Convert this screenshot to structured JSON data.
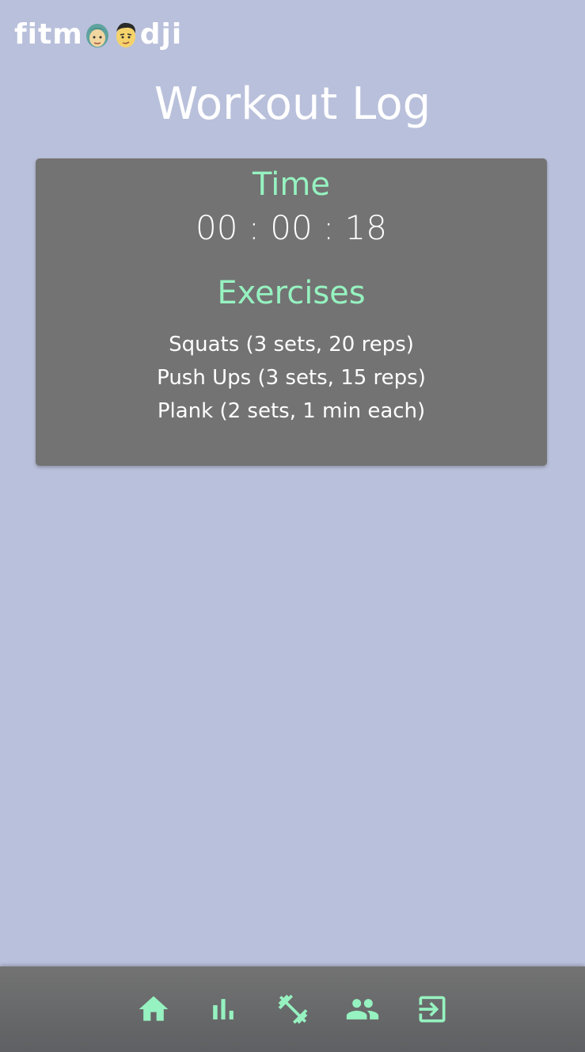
{
  "app": {
    "logo_left": "fitm",
    "logo_right": "dji"
  },
  "page": {
    "title": "Workout Log"
  },
  "workout": {
    "time_heading": "Time",
    "timer": "00 : 00 : 18",
    "exercises_heading": "Exercises",
    "exercises": [
      "Squats (3 sets, 20 reps)",
      "Push Ups (3 sets, 15 reps)",
      "Plank (2 sets, 1 min each)"
    ]
  },
  "nav": {
    "items": [
      {
        "icon": "home-icon"
      },
      {
        "icon": "bar-chart-icon"
      },
      {
        "icon": "dumbbell-icon"
      },
      {
        "icon": "people-icon"
      },
      {
        "icon": "logout-icon"
      }
    ]
  },
  "colors": {
    "background": "#b9c0db",
    "card": "#737373",
    "accent": "#96f2c0",
    "text": "#ffffff"
  }
}
